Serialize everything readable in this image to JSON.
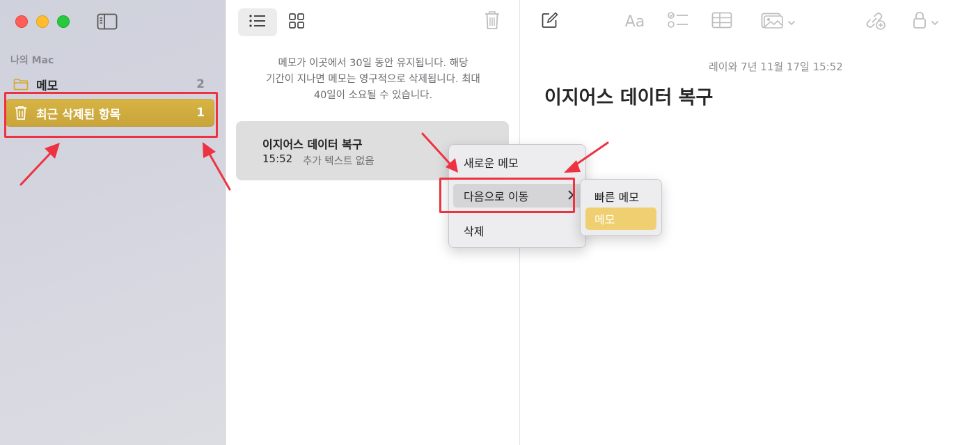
{
  "sidebar": {
    "section_label": "나의 Mac",
    "folders": [
      {
        "name": "메모",
        "count": "2",
        "icon": "folder-icon"
      },
      {
        "name": "최근 삭제된 항목",
        "count": "1",
        "icon": "trash-icon"
      }
    ]
  },
  "list": {
    "notice_lines": [
      "메모가 이곳에서 30일 동안 유지됩니다. 해당",
      "기간이 지나면 메모는 영구적으로 삭제됩니다. 최대",
      "40일이 소요될 수 있습니다."
    ],
    "note": {
      "title": "이지어스 데이터 복구",
      "time": "15:52",
      "snippet": "추가 텍스트 없음"
    }
  },
  "editor": {
    "date": "레이와 7년 11월 17일 15:52",
    "title": "이지어스 데이터 복구",
    "format_label": "Aa"
  },
  "context_menu": {
    "items": [
      "새로운 메모",
      "다음으로 이동",
      "삭제"
    ],
    "submenu": [
      "빠른 메모",
      "메모"
    ]
  },
  "colors": {
    "accent_yellow": "#d7b444",
    "highlight_red": "#ee3242",
    "selected_submenu": "#efcf6f"
  }
}
